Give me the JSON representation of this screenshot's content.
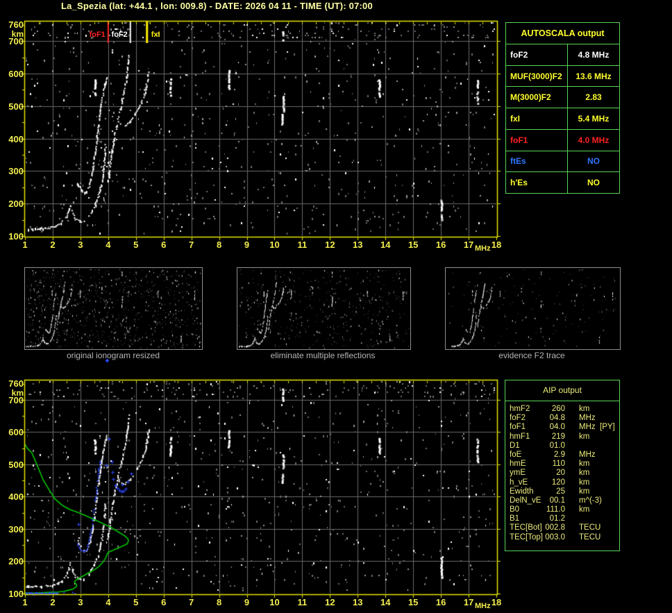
{
  "title": "La_Spezia (lat: +44.1 , lon: 009.8) - DATE: 2026 04 11 - TIME (UT): 07:00",
  "colors": {
    "background": "#000000",
    "title_text": "#ffffa6",
    "plot_border": "#e6e600",
    "axis_label": "#f2ee4e",
    "grid": "#6b6b6b",
    "echo_white": "#ffffff",
    "noise_gray": "#6e6e6e",
    "profile_green": "#00c800",
    "overlay_blue": "#2b46ff",
    "table_border_green": "#58d658",
    "yellow": "#ffff2e",
    "white": "#ffffff",
    "red": "#ff2222",
    "blue": "#2e78ff",
    "aip_text": "#ecec7c",
    "caption_gray": "#b5b5b5",
    "panel_border": "#8f8f8f"
  },
  "autoscala_table": {
    "title": "AUTOSCALA output",
    "rows": [
      {
        "label": "foF2",
        "value": "4.8 MHz",
        "color": "white"
      },
      {
        "label": "MUF(3000)F2",
        "value": "13.6 MHz",
        "color": "yellow"
      },
      {
        "label": "M(3000)F2",
        "value": "2.83",
        "color": "yellow"
      },
      {
        "label": "fxI",
        "value": "5.4 MHz",
        "color": "yellow"
      },
      {
        "label": "foF1",
        "value": "4.0 MHz",
        "color": "red"
      },
      {
        "label": "ftEs",
        "value": "NO",
        "color": "blue"
      },
      {
        "label": "h'Es",
        "value": "NO",
        "color": "yellow"
      }
    ]
  },
  "aip_table": {
    "title": "AIP output",
    "rows": [
      {
        "label": "hmF2",
        "value": "260",
        "unit": "km",
        "extra": ""
      },
      {
        "label": "foF2",
        "value": "04.8",
        "unit": "MHz",
        "extra": ""
      },
      {
        "label": "foF1",
        "value": "04.0",
        "unit": "MHz",
        "extra": "[PY]"
      },
      {
        "label": "hmF1",
        "value": "219",
        "unit": "km",
        "extra": ""
      },
      {
        "label": "D1",
        "value": "01.0",
        "unit": "",
        "extra": ""
      },
      {
        "label": "foE",
        "value": "2.9",
        "unit": "MHz",
        "extra": ""
      },
      {
        "label": "hmE",
        "value": "110",
        "unit": "km",
        "extra": ""
      },
      {
        "label": "ymE",
        "value": "20",
        "unit": "km",
        "extra": ""
      },
      {
        "label": "h_vE",
        "value": "120",
        "unit": "km",
        "extra": ""
      },
      {
        "label": "Ewidth",
        "value": "25",
        "unit": "km",
        "extra": ""
      },
      {
        "label": "DelN_vE",
        "value": "00.1",
        "unit": "m^(-3)",
        "extra": ""
      },
      {
        "label": "B0",
        "value": "111.0",
        "unit": "km",
        "extra": ""
      },
      {
        "label": "B1",
        "value": "01.2",
        "unit": "",
        "extra": ""
      },
      {
        "label": "TEC[Bot]",
        "value": "002.8",
        "unit": "TECU",
        "extra": ""
      },
      {
        "label": "TEC[Top]",
        "value": "003.0",
        "unit": "TECU",
        "extra": ""
      }
    ]
  },
  "panels": [
    {
      "caption": "original ionogram resized",
      "noise_level": "high"
    },
    {
      "caption": "eliminate multiple reflections",
      "noise_level": "medium"
    },
    {
      "caption": "evidence F2 trace",
      "noise_level": "low"
    }
  ],
  "chart_data": [
    {
      "type": "scatter",
      "name": "autoscaled ionogram (virtual height vs frequency)",
      "xlabel": "MHz",
      "ylabel": "km",
      "xlim": [
        1,
        18
      ],
      "ylim": [
        100,
        760
      ],
      "xticks": [
        1,
        2,
        3,
        4,
        5,
        6,
        7,
        8,
        9,
        10,
        11,
        12,
        13,
        14,
        15,
        16,
        17,
        18
      ],
      "yticks": [
        760,
        700,
        600,
        500,
        400,
        300,
        200,
        100
      ],
      "grid": {
        "x_step_mhz": 1,
        "y_step_km": 100,
        "on": true
      },
      "markers": [
        {
          "label": "foF1",
          "freq": 4.0,
          "color": "#ff2222",
          "label_side": "left"
        },
        {
          "label": "foF2",
          "freq": 4.8,
          "color": "#ffffff",
          "label_side": "left"
        },
        {
          "label": "fxI",
          "freq": 5.4,
          "color": "#ffee00",
          "label_side": "right"
        }
      ],
      "echo_traces": [
        {
          "name": "E-layer",
          "points": [
            [
              1.05,
              122
            ],
            [
              1.2,
              121
            ],
            [
              1.35,
              122
            ],
            [
              1.5,
              123
            ],
            [
              1.65,
              122
            ],
            [
              1.8,
              124
            ],
            [
              1.95,
              126
            ],
            [
              2.1,
              128
            ],
            [
              2.2,
              132
            ],
            [
              2.3,
              138
            ],
            [
              2.4,
              147
            ],
            [
              2.5,
              159
            ],
            [
              2.57,
              172
            ],
            [
              2.62,
              186
            ],
            [
              2.66,
              198
            ]
          ]
        },
        {
          "name": "E-F-cusp",
          "points": [
            [
              2.7,
              176
            ],
            [
              2.76,
              162
            ],
            [
              2.83,
              152
            ],
            [
              2.92,
              147
            ],
            [
              3.02,
              144
            ],
            [
              3.12,
              145
            ],
            [
              3.2,
              149
            ]
          ]
        },
        {
          "name": "F1-trace",
          "points": [
            [
              3.28,
              158
            ],
            [
              3.4,
              172
            ],
            [
              3.52,
              190
            ],
            [
              3.62,
              212
            ],
            [
              3.7,
              236
            ],
            [
              3.77,
              262
            ],
            [
              3.82,
              290
            ],
            [
              3.86,
              320
            ],
            [
              3.89,
              352
            ],
            [
              3.91,
              385
            ]
          ]
        },
        {
          "name": "F-trace-high",
          "points": [
            [
              2.9,
              262
            ],
            [
              3.0,
              247
            ],
            [
              3.1,
              238
            ],
            [
              3.2,
              233
            ],
            [
              3.28,
              242
            ],
            [
              3.35,
              262
            ],
            [
              3.42,
              290
            ],
            [
              3.5,
              330
            ],
            [
              3.57,
              375
            ],
            [
              3.63,
              420
            ],
            [
              3.7,
              470
            ],
            [
              3.78,
              520
            ],
            [
              3.87,
              562
            ],
            [
              3.97,
              592
            ]
          ]
        },
        {
          "name": "F2-trace",
          "points": [
            [
              4.0,
              268
            ],
            [
              4.05,
              298
            ],
            [
              4.1,
              335
            ],
            [
              4.17,
              375
            ],
            [
              4.25,
              415
            ],
            [
              4.34,
              452
            ],
            [
              4.44,
              490
            ],
            [
              4.53,
              525
            ],
            [
              4.61,
              558
            ],
            [
              4.68,
              592
            ],
            [
              4.73,
              625
            ],
            [
              4.76,
              658
            ]
          ]
        },
        {
          "name": "X-mode-trace",
          "points": [
            [
              4.38,
              452
            ],
            [
              4.5,
              440
            ],
            [
              4.62,
              440
            ],
            [
              4.75,
              448
            ],
            [
              4.88,
              462
            ],
            [
              5.02,
              480
            ],
            [
              5.15,
              498
            ],
            [
              5.26,
              520
            ],
            [
              5.35,
              548
            ],
            [
              5.42,
              578
            ],
            [
              5.47,
              612
            ]
          ]
        }
      ],
      "streaks": [
        [
          3.53,
          537,
          586
        ],
        [
          6.25,
          530,
          586
        ],
        [
          8.35,
          556,
          614
        ],
        [
          10.3,
          700,
          738
        ],
        [
          10.32,
          486,
          534
        ],
        [
          10.28,
          446,
          480
        ],
        [
          13.78,
          532,
          582
        ],
        [
          16.02,
          152,
          214
        ],
        [
          17.32,
          510,
          580
        ]
      ]
    },
    {
      "type": "scatter",
      "name": "AIP electron density profile over ionogram",
      "xlabel": "MHz",
      "ylabel": "km",
      "xlim": [
        1,
        18
      ],
      "ylim": [
        100,
        760
      ],
      "xticks": [
        1,
        2,
        3,
        4,
        5,
        6,
        7,
        8,
        9,
        10,
        11,
        12,
        13,
        14,
        15,
        16,
        17,
        18
      ],
      "yticks": [
        760,
        700,
        600,
        500,
        400,
        300,
        200,
        100
      ],
      "echo_traces_ref": 0,
      "profile_green": [
        [
          1.0,
          562
        ],
        [
          1.1,
          548
        ],
        [
          1.24,
          537
        ],
        [
          1.45,
          495
        ],
        [
          1.66,
          451
        ],
        [
          1.88,
          420
        ],
        [
          2.08,
          393
        ],
        [
          2.35,
          373
        ],
        [
          2.62,
          360
        ],
        [
          2.95,
          350
        ],
        [
          3.3,
          337
        ],
        [
          3.71,
          321
        ],
        [
          4.1,
          305
        ],
        [
          4.42,
          288
        ],
        [
          4.62,
          277
        ],
        [
          4.71,
          270
        ],
        [
          4.73,
          262
        ],
        [
          4.68,
          254
        ],
        [
          4.54,
          248
        ],
        [
          4.35,
          241
        ],
        [
          4.17,
          234
        ],
        [
          4.02,
          229
        ],
        [
          3.95,
          220
        ],
        [
          3.92,
          212
        ],
        [
          3.8,
          196
        ],
        [
          3.67,
          184
        ],
        [
          3.5,
          174
        ],
        [
          3.33,
          166
        ],
        [
          3.13,
          156
        ],
        [
          2.95,
          148
        ],
        [
          2.83,
          141
        ],
        [
          2.79,
          136
        ],
        [
          2.82,
          131
        ],
        [
          2.87,
          127
        ],
        [
          2.85,
          122
        ],
        [
          2.8,
          118
        ],
        [
          2.72,
          114
        ],
        [
          2.6,
          111
        ],
        [
          2.4,
          107
        ],
        [
          2.2,
          105
        ],
        [
          1.95,
          104
        ],
        [
          1.7,
          103
        ],
        [
          1.4,
          102
        ],
        [
          1.15,
          102
        ],
        [
          1.0,
          102
        ]
      ],
      "blue_trace_bottom": {
        "from_mhz": 1.02,
        "to_mhz": 2.2,
        "km": 102
      },
      "blue_follow_trace": {
        "trace": "F-trace-high",
        "from_mhz": 2.9,
        "to_mhz": 3.82
      },
      "blue_marks": [
        [
          2.94,
          315
        ],
        [
          4.04,
          580
        ],
        [
          3.94,
          497
        ],
        [
          4.14,
          508
        ],
        [
          4.15,
          476
        ],
        [
          4.19,
          454
        ],
        [
          4.25,
          436
        ],
        [
          4.32,
          426
        ],
        [
          4.4,
          420
        ],
        [
          4.48,
          417
        ],
        [
          4.5,
          438
        ],
        [
          4.56,
          419
        ],
        [
          4.64,
          424
        ],
        [
          4.71,
          447
        ],
        [
          4.84,
          472
        ]
      ]
    }
  ]
}
